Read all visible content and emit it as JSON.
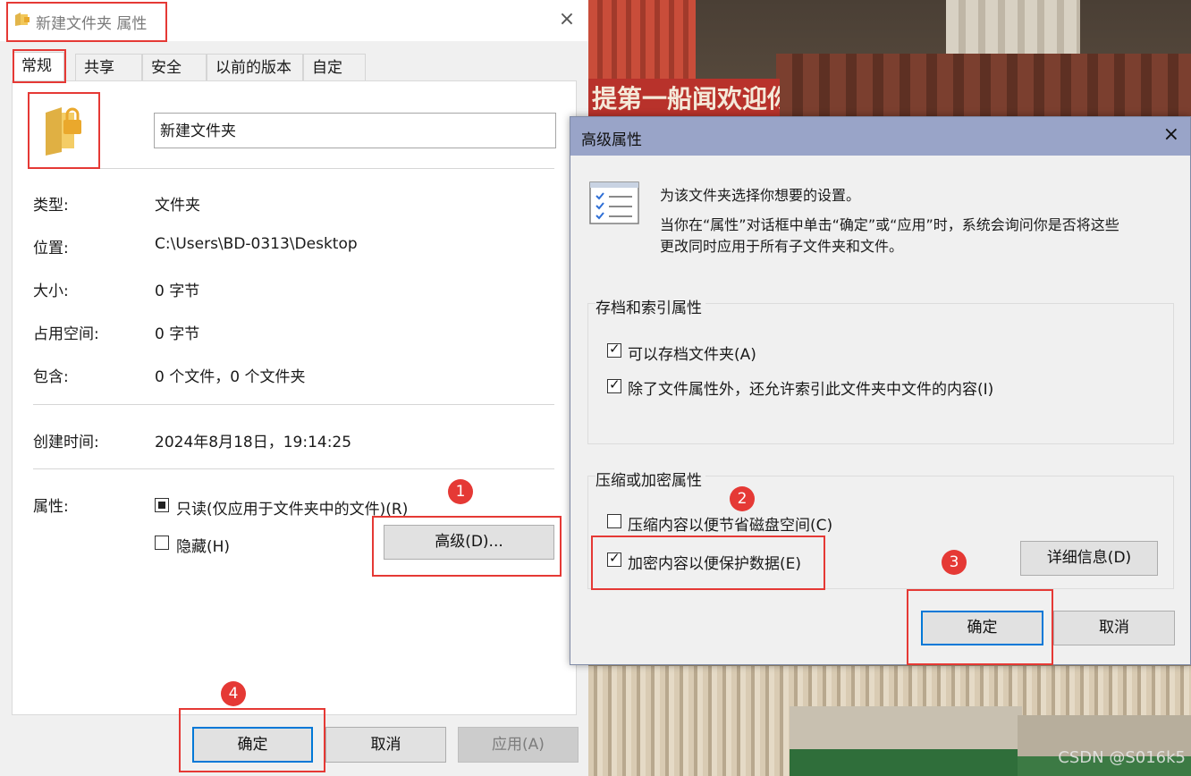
{
  "background": {
    "banner_text": "提第一船闻欢迎你",
    "watermark": "CSDN @S016k5"
  },
  "props_window": {
    "title": "新建文件夹 属性",
    "close_icon": "×",
    "tabs": [
      "常规",
      "共享",
      "安全",
      "以前的版本",
      "自定义"
    ],
    "folder_name": "新建文件夹",
    "rows": [
      {
        "label": "类型:",
        "value": "文件夹"
      },
      {
        "label": "位置:",
        "value": "C:\\Users\\BD-0313\\Desktop"
      },
      {
        "label": "大小:",
        "value": "0 字节"
      },
      {
        "label": "占用空间:",
        "value": "0 字节"
      },
      {
        "label": "包含:",
        "value": "0 个文件，0 个文件夹"
      }
    ],
    "created_label": "创建时间:",
    "created_value": "2024年8月18日，19:14:25",
    "attributes_label": "属性:",
    "readonly_label": "只读(仅应用于文件夹中的文件)(R)",
    "hidden_label": "隐藏(H)",
    "advanced_button": "高级(D)...",
    "ok_button": "确定",
    "cancel_button": "取消",
    "apply_button": "应用(A)"
  },
  "advanced_dialog": {
    "title": "高级属性",
    "close_icon": "×",
    "intro_line1": "为该文件夹选择你想要的设置。",
    "intro_line2": "当你在“属性”对话框中单击“确定”或“应用”时，系统会询问你是否将这些",
    "intro_line3": "更改同时应用于所有子文件夹和文件。",
    "archive_group": "存档和索引属性",
    "archive_label": "可以存档文件夹(A)",
    "index_label": "除了文件属性外，还允许索引此文件夹中文件的内容(I)",
    "compress_group": "压缩或加密属性",
    "compress_label": "压缩内容以便节省磁盘空间(C)",
    "encrypt_label": "加密内容以便保护数据(E)",
    "details_button": "详细信息(D)",
    "ok_button": "确定",
    "cancel_button": "取消",
    "archive_checked": true,
    "index_checked": true,
    "compress_checked": false,
    "encrypt_checked": true
  },
  "markers": [
    "1",
    "2",
    "3",
    "4"
  ],
  "colors": {
    "annotation": "#e53935",
    "dialog_titlebar": "#99a4c8",
    "focus_border": "#0078d7"
  }
}
